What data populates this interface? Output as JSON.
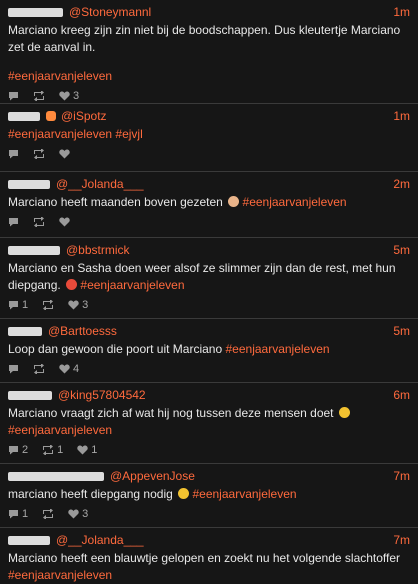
{
  "tweets": [
    {
      "handle": "@Stoneymannl",
      "time": "1m",
      "text": "Marciano kreeg zijn zin niet bij de boodschappen. Dus kleutertje Marciano zet de aanval in.",
      "hashtags": "#eenjaarvanjeleven",
      "replies": "",
      "retweets": "",
      "likes": "3"
    },
    {
      "handle": "@iSpotz",
      "time": "1m",
      "text": "",
      "hashtags": "#eenjaarvanjeleven #ejvjl",
      "replies": "",
      "retweets": "",
      "likes": ""
    },
    {
      "handle": "@__Jolanda___",
      "time": "2m",
      "text": "Marciano heeft maanden boven gezeten",
      "hashtags": "#eenjaarvanjeleven",
      "replies": "",
      "retweets": "",
      "likes": ""
    },
    {
      "handle": "@bbstrmick",
      "time": "5m",
      "text": "Marciano en Sasha doen weer alsof ze slimmer zijn dan de rest, met hun diepgang.",
      "hashtags": "#eenjaarvanjeleven",
      "replies": "1",
      "retweets": "",
      "likes": "3"
    },
    {
      "handle": "@Barttoesss",
      "time": "5m",
      "text": "Loop dan gewoon die poort uit Marciano",
      "hashtags": "#eenjaarvanjeleven",
      "replies": "",
      "retweets": "",
      "likes": "4"
    },
    {
      "handle": "@king57804542",
      "time": "6m",
      "text": "Marciano vraagt zich af wat hij nog tussen deze mensen doet",
      "hashtags": "#eenjaarvanjeleven",
      "replies": "2",
      "retweets": "1",
      "likes": "1"
    },
    {
      "handle": "@AppevenJose",
      "time": "7m",
      "text": "marciano heeft diepgang nodig",
      "hashtags": "#eenjaarvanjeleven",
      "replies": "1",
      "retweets": "",
      "likes": "3"
    },
    {
      "handle": "@__Jolanda___",
      "time": "7m",
      "text": "Marciano heeft een blauwtje gelopen en zoekt nu het volgende slachtoffer",
      "hashtags": "#eenjaarvanjeleven",
      "replies": "",
      "retweets": "",
      "likes": ""
    }
  ],
  "colors": {
    "accent": "#ff6a3d",
    "background": "#161616",
    "divider": "#3a3a3a"
  },
  "icons": {
    "reply": "reply-icon",
    "retweet": "retweet-icon",
    "like": "heart-icon"
  }
}
